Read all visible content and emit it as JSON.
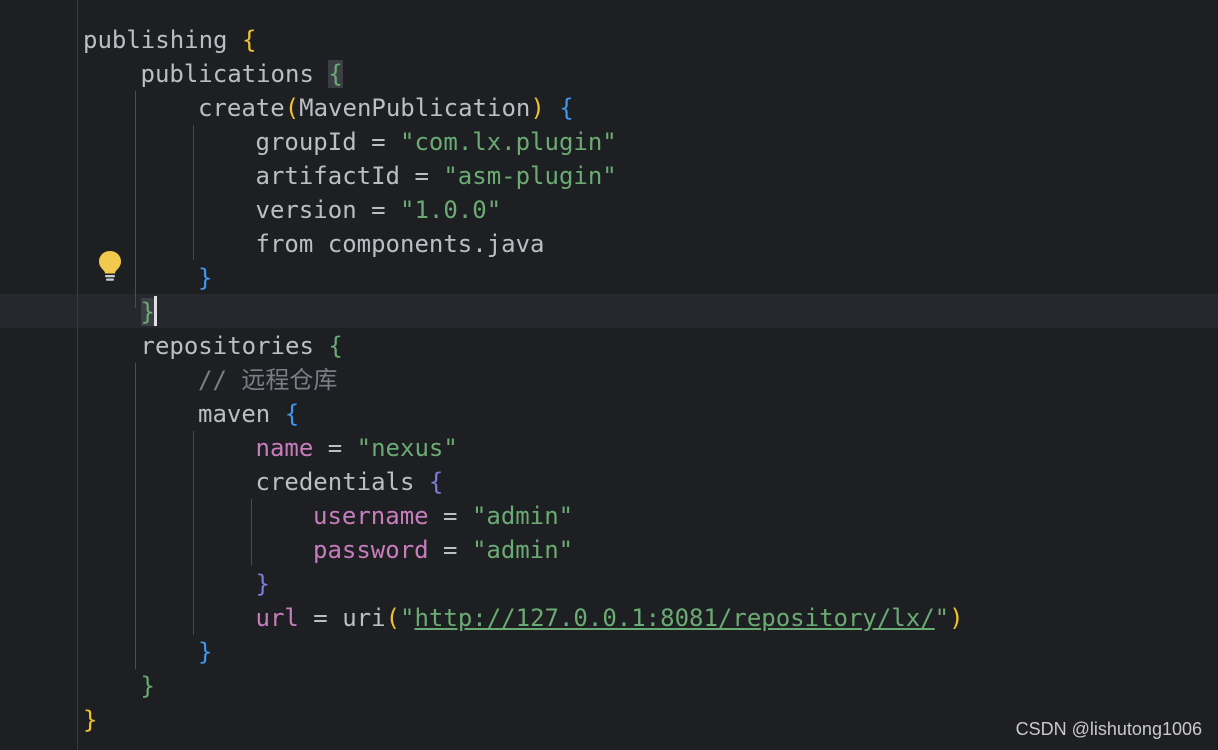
{
  "editor": {
    "language": "gradle-kotlin",
    "lines": [
      {
        "kw": "publishing",
        "open": "{"
      },
      {
        "kw": "publications",
        "open": "{"
      },
      {
        "fn": "create",
        "lp": "(",
        "arg": "MavenPublication",
        "rp": ")",
        "open": "{"
      },
      {
        "key": "groupId",
        "eq": " = ",
        "val": "\"com.lx.plugin\""
      },
      {
        "key": "artifactId",
        "eq": " = ",
        "val": "\"asm-plugin\""
      },
      {
        "key": "version",
        "eq": " = ",
        "val": "\"1.0.0\""
      },
      {
        "text": "from components.java"
      },
      {
        "close": "}"
      },
      {
        "close": "}"
      },
      {
        "kw": "repositories",
        "open": "{"
      },
      {
        "comment": "// 远程仓库"
      },
      {
        "kw": "maven",
        "open": "{"
      },
      {
        "key": "name",
        "eq": " = ",
        "val": "\"nexus\""
      },
      {
        "kw": "credentials",
        "open": "{"
      },
      {
        "key": "username",
        "eq": " = ",
        "val": "\"admin\""
      },
      {
        "key": "password",
        "eq": " = ",
        "val": "\"admin\""
      },
      {
        "close": "}"
      },
      {
        "key": "url",
        "eq": " = ",
        "fn": "uri",
        "lp": "(",
        "q1": "\"",
        "url": "http://127.0.0.1:8081/repository/lx/",
        "q2": "\"",
        "rp": ")"
      },
      {
        "close": "}"
      },
      {
        "close": "}"
      },
      {
        "close": "}"
      }
    ]
  },
  "icons": {
    "intention": "lightbulb-icon"
  },
  "watermark": "CSDN @lishutong1006",
  "colors": {
    "background": "#1e1f22",
    "text": "#bcbec4",
    "string": "#6aab73",
    "property": "#c77dbb",
    "comment": "#7a7e85",
    "brace_level1": "#f0c22e",
    "brace_level2": "#6aab73",
    "brace_level3": "#3e97f0",
    "brace_level4": "#7a7ddb",
    "caret_row": "#26282e"
  }
}
